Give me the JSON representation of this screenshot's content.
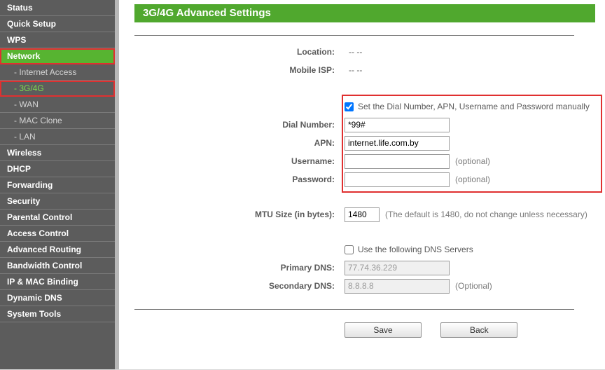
{
  "sidebar": {
    "items": [
      {
        "label": "Status",
        "kind": "item"
      },
      {
        "label": "Quick Setup",
        "kind": "item"
      },
      {
        "label": "WPS",
        "kind": "item"
      },
      {
        "label": "Network",
        "kind": "item",
        "active": true,
        "highlight": true
      },
      {
        "label": "- Internet Access",
        "kind": "sub"
      },
      {
        "label": "- 3G/4G",
        "kind": "sub",
        "active": true,
        "highlight": true
      },
      {
        "label": "- WAN",
        "kind": "sub"
      },
      {
        "label": "- MAC Clone",
        "kind": "sub"
      },
      {
        "label": "- LAN",
        "kind": "sub"
      },
      {
        "label": "Wireless",
        "kind": "item"
      },
      {
        "label": "DHCP",
        "kind": "item"
      },
      {
        "label": "Forwarding",
        "kind": "item"
      },
      {
        "label": "Security",
        "kind": "item"
      },
      {
        "label": "Parental Control",
        "kind": "item"
      },
      {
        "label": "Access Control",
        "kind": "item"
      },
      {
        "label": "Advanced Routing",
        "kind": "item"
      },
      {
        "label": "Bandwidth Control",
        "kind": "item"
      },
      {
        "label": "IP & MAC Binding",
        "kind": "item"
      },
      {
        "label": "Dynamic DNS",
        "kind": "item"
      },
      {
        "label": "System Tools",
        "kind": "item"
      }
    ]
  },
  "page": {
    "title": "3G/4G Advanced Settings"
  },
  "form": {
    "location_label": "Location:",
    "location_value": "--  --",
    "isp_label": "Mobile ISP:",
    "isp_value": "--  --",
    "manual_check_label": "Set the Dial Number, APN, Username and Password manually",
    "manual_checked": true,
    "dial_label": "Dial Number:",
    "dial_value": "*99#",
    "apn_label": "APN:",
    "apn_value": "internet.life.com.by",
    "user_label": "Username:",
    "user_value": "",
    "user_hint": "(optional)",
    "pass_label": "Password:",
    "pass_value": "",
    "pass_hint": "(optional)",
    "mtu_label": "MTU Size (in bytes):",
    "mtu_value": "1480",
    "mtu_hint": "(The default is 1480, do not change unless necessary)",
    "dns_check_label": "Use the following DNS Servers",
    "dns_checked": false,
    "pdns_label": "Primary DNS:",
    "pdns_value": "77.74.36.229",
    "sdns_label": "Secondary DNS:",
    "sdns_value": "8.8.8.8",
    "sdns_hint": "(Optional)",
    "save_btn": "Save",
    "back_btn": "Back"
  }
}
